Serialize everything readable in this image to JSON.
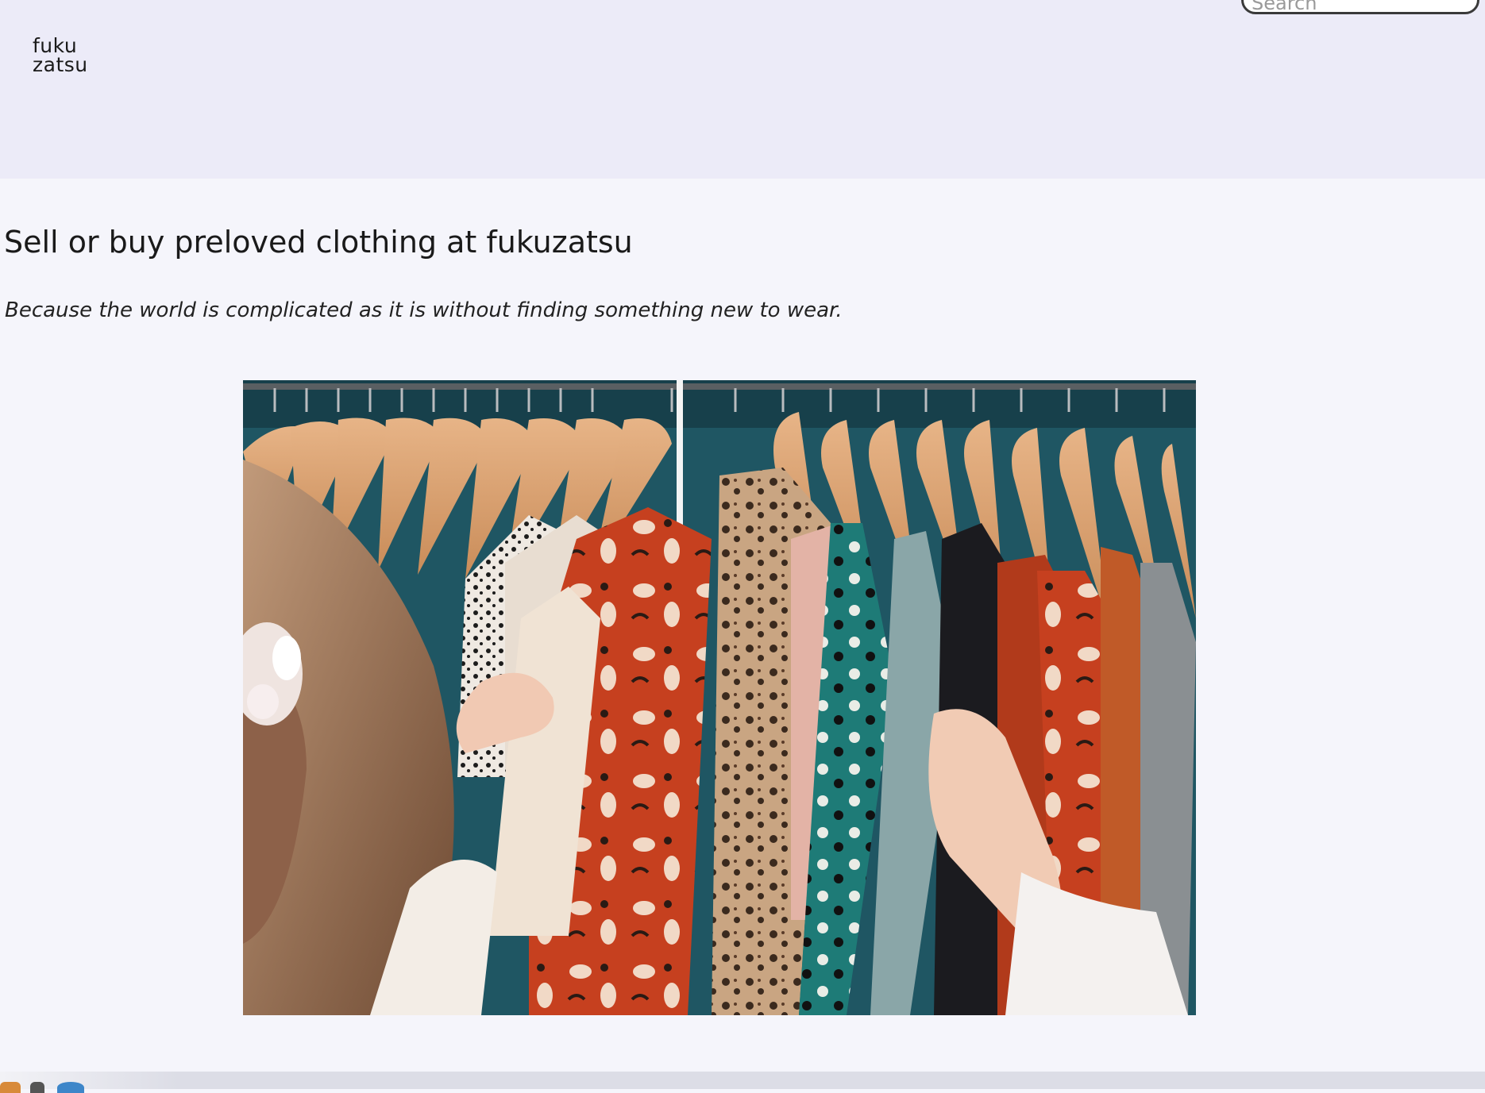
{
  "header": {
    "logo_line1": "fuku",
    "logo_line2": "zatsu",
    "search_placeholder": "Search"
  },
  "main": {
    "title": "Sell or buy preloved clothing at fukuzatsu",
    "tagline": "Because the world is complicated as it is without finding something new to wear."
  },
  "hero": {
    "alt": "Person browsing colorful preloved clothing on hangers"
  },
  "colors": {
    "header_bg": "#ecebf8",
    "page_bg": "#f5f5fb",
    "text": "#1a1a1a"
  }
}
